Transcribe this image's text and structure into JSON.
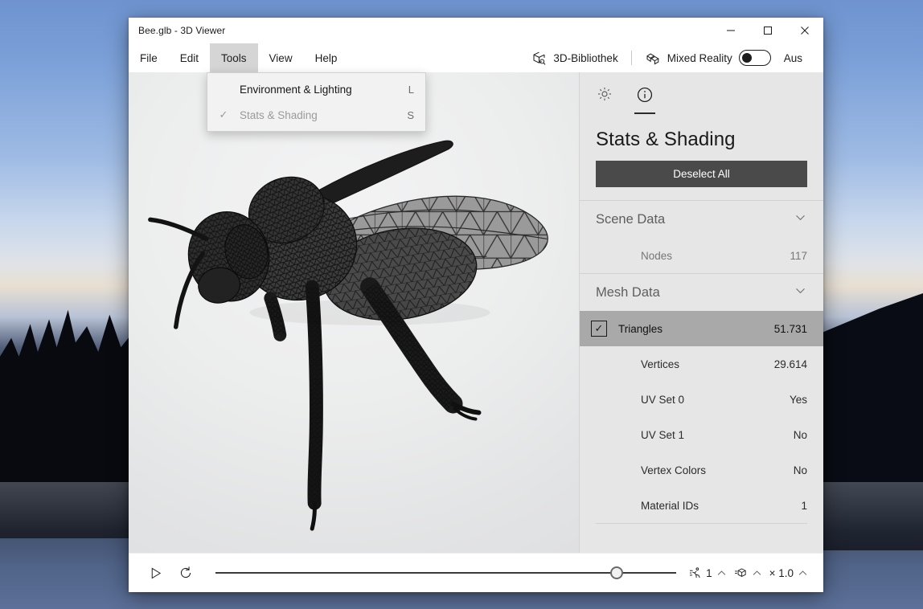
{
  "window": {
    "title": "Bee.glb - 3D Viewer",
    "controls": {
      "minimize": "minimize-icon",
      "maximize": "maximize-icon",
      "close": "close-icon"
    }
  },
  "menubar": {
    "items": [
      {
        "label": "File",
        "open": false
      },
      {
        "label": "Edit",
        "open": false
      },
      {
        "label": "Tools",
        "open": true
      },
      {
        "label": "View",
        "open": false
      },
      {
        "label": "Help",
        "open": false
      }
    ],
    "library": {
      "label": "3D-Bibliothek",
      "icon": "cube-search-icon"
    },
    "mixed_reality": {
      "label": "Mixed Reality",
      "icon": "mixed-reality-icon",
      "toggle_state": "Aus",
      "toggle_on": false
    }
  },
  "dropdown": {
    "owner": "Tools",
    "items": [
      {
        "label": "Environment & Lighting",
        "accel": "L",
        "checked": false,
        "disabled": false
      },
      {
        "label": "Stats & Shading",
        "accel": "S",
        "checked": true,
        "disabled": true
      }
    ],
    "check_glyph": "✓"
  },
  "viewport": {
    "model_name": "Bee.glb",
    "render_mode": "wireframe"
  },
  "panel": {
    "tabs": [
      {
        "name": "lighting",
        "icon": "sun-icon",
        "active": false
      },
      {
        "name": "stats",
        "icon": "info-circle-icon",
        "active": true
      }
    ],
    "title": "Stats & Shading",
    "deselect_label": "Deselect All",
    "sections": [
      {
        "name": "scene-data",
        "title": "Scene Data",
        "expanded": true,
        "rows": [
          {
            "label": "Nodes",
            "value": "117",
            "muted": true,
            "selected": false,
            "checkbox": false
          }
        ]
      },
      {
        "name": "mesh-data",
        "title": "Mesh Data",
        "expanded": true,
        "rows": [
          {
            "label": "Triangles",
            "value": "51.731",
            "muted": false,
            "selected": true,
            "checkbox": true,
            "checked": true
          },
          {
            "label": "Vertices",
            "value": "29.614",
            "muted": false,
            "selected": false,
            "checkbox": false
          },
          {
            "label": "UV Set 0",
            "value": "Yes",
            "muted": false,
            "selected": false,
            "checkbox": false
          },
          {
            "label": "UV Set 1",
            "value": "No",
            "muted": false,
            "selected": false,
            "checkbox": false
          },
          {
            "label": "Vertex Colors",
            "value": "No",
            "muted": false,
            "selected": false,
            "checkbox": false
          },
          {
            "label": "Material IDs",
            "value": "1",
            "muted": false,
            "selected": false,
            "checkbox": false
          }
        ]
      }
    ],
    "chevron_glyph": "⌄",
    "check_glyph": "✓"
  },
  "bottombar": {
    "play_icon": "play-icon",
    "reset_icon": "reset-icon",
    "slider_percent": 87,
    "animation": {
      "icon": "animation-run-icon",
      "value": "1",
      "chevron": "chevron-up-icon"
    },
    "model": {
      "icon": "model-cube-icon",
      "value": "",
      "chevron": "chevron-up-icon"
    },
    "speed": {
      "value": "× 1.0",
      "chevron": "chevron-up-icon"
    }
  },
  "colors": {
    "accent_dark": "#4a4a4a",
    "panel_bg": "#e6e6e6",
    "selected_row": "#a9a9a9",
    "window_bg": "#ffffff"
  }
}
